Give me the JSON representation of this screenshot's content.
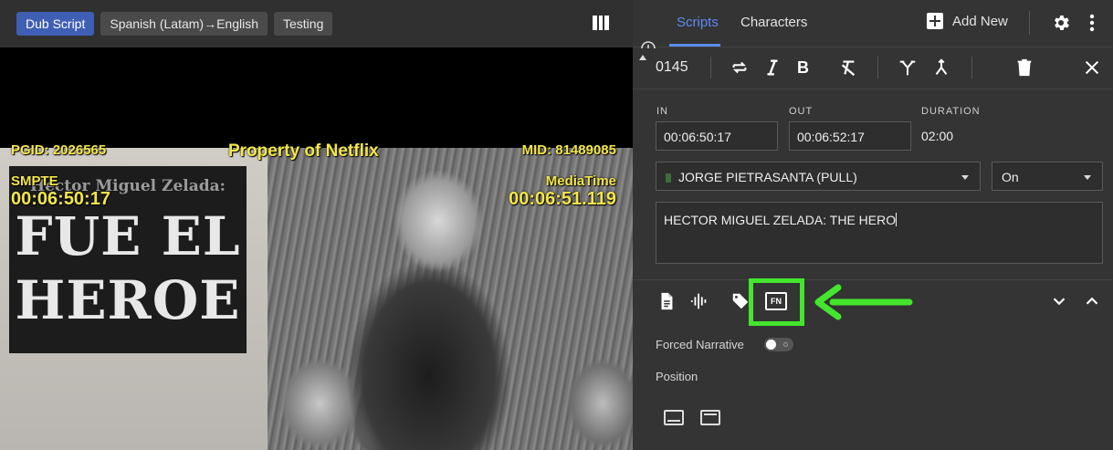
{
  "video_toolbar": {
    "chips": [
      "Dub Script",
      "Spanish (Latam)→English",
      "Testing"
    ],
    "active_chip": "Dub Script"
  },
  "video": {
    "burn_in": {
      "pgid": "PGID: 2026565",
      "property": "Property of Netflix",
      "mid": "MID: 81489085",
      "smpte_label": "SMPTE",
      "smpte_tc": "00:06:50:17",
      "mediatime_label": "MediaTime",
      "mediatime_tc": "00:06:51.119"
    },
    "title_card": {
      "caption": "Hector Miguel Zelada:",
      "headline_line1": "FUE EL",
      "headline_line2": "HEROE"
    }
  },
  "panel": {
    "tabs": [
      "Scripts",
      "Characters"
    ],
    "active_tab": "Scripts",
    "add_new_label": "Add New",
    "clip_id": "0145",
    "in_label": "IN",
    "in_value": "00:06:50:17",
    "out_label": "OUT",
    "out_value": "00:06:52:17",
    "duration_label": "DURATION",
    "duration_value": "02:00",
    "character_select": "JORGE PIETRASANTA (PULL)",
    "character_color": "#3c6e3c",
    "status_select": "On",
    "script_text": "HECTOR MIGUEL ZELADA: THE HERO",
    "forced_narrative_label": "Forced Narrative",
    "forced_narrative_on": false,
    "position_label": "Position",
    "fn_badge": "FN"
  },
  "colors": {
    "accent": "#5b8bf0",
    "chip_active": "#3f5fb5",
    "highlight": "#43e62c",
    "burn_in_text": "#f4e64a"
  },
  "icons": {
    "toolbar": [
      "repeat-icon",
      "italic-icon",
      "bold-icon",
      "clear-format-icon",
      "split-icon",
      "merge-icon",
      "delete-icon",
      "close-icon"
    ],
    "detail_row": [
      "document-icon",
      "waveform-icon",
      "tag-icon",
      "fn-icon"
    ],
    "position": [
      "position-bottom-icon",
      "position-top-icon"
    ]
  }
}
